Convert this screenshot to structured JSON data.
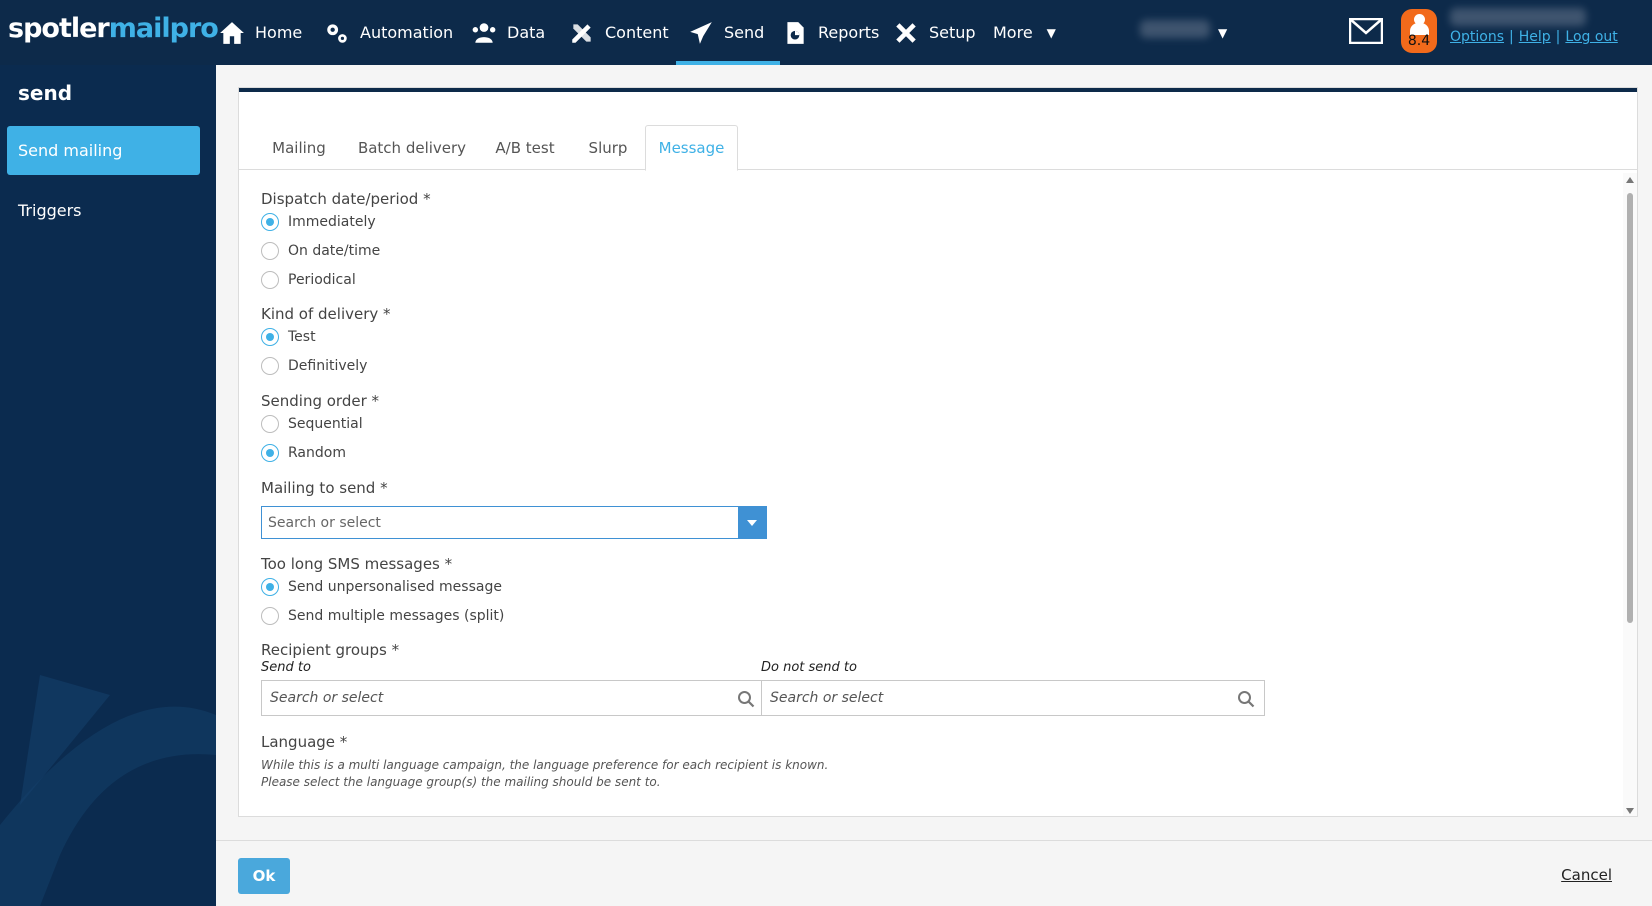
{
  "logo": {
    "part1": "spotler",
    "part2": "mailpro"
  },
  "nav": {
    "home": "Home",
    "automation": "Automation",
    "data": "Data",
    "content": "Content",
    "send": "Send",
    "reports": "Reports",
    "setup": "Setup",
    "more": "More"
  },
  "header": {
    "badge_score": "8.4",
    "links": {
      "options": "Options",
      "help": "Help",
      "logout": "Log out",
      "sep": "|"
    }
  },
  "sidebar": {
    "title": "send",
    "items": [
      {
        "label": "Send mailing",
        "active": true
      },
      {
        "label": "Triggers",
        "active": false
      }
    ]
  },
  "tabs": [
    "Mailing",
    "Batch delivery",
    "A/B test",
    "Slurp",
    "Message"
  ],
  "form": {
    "dispatch": {
      "label": "Dispatch date/period *",
      "options": [
        "Immediately",
        "On date/time",
        "Periodical"
      ],
      "selected": "Immediately"
    },
    "delivery": {
      "label": "Kind of delivery *",
      "options": [
        "Test",
        "Definitively"
      ],
      "selected": "Test"
    },
    "order": {
      "label": "Sending order *",
      "options": [
        "Sequential",
        "Random"
      ],
      "selected": "Random"
    },
    "mailing": {
      "label": "Mailing to send *",
      "placeholder": "Search or select"
    },
    "sms": {
      "label": "Too long SMS messages *",
      "options": [
        "Send unpersonalised message",
        "Send multiple messages (split)"
      ],
      "selected": "Send unpersonalised message"
    },
    "recipients": {
      "label": "Recipient groups *",
      "send_to": "Send to",
      "send_to_placeholder": "Search or select",
      "not_send_to": "Do not send to",
      "not_send_to_placeholder": "Search or select"
    },
    "language": {
      "label": "Language *",
      "hint1": "While this is a multi language campaign, the language preference for each recipient is known.",
      "hint2": "Please select the language group(s) the mailing should be sent to."
    }
  },
  "footer": {
    "ok": "Ok",
    "cancel": "Cancel"
  },
  "colors": {
    "nav_bg": "#0d2a4a",
    "accent": "#3fb1e6",
    "badge": "#f26a1b"
  }
}
